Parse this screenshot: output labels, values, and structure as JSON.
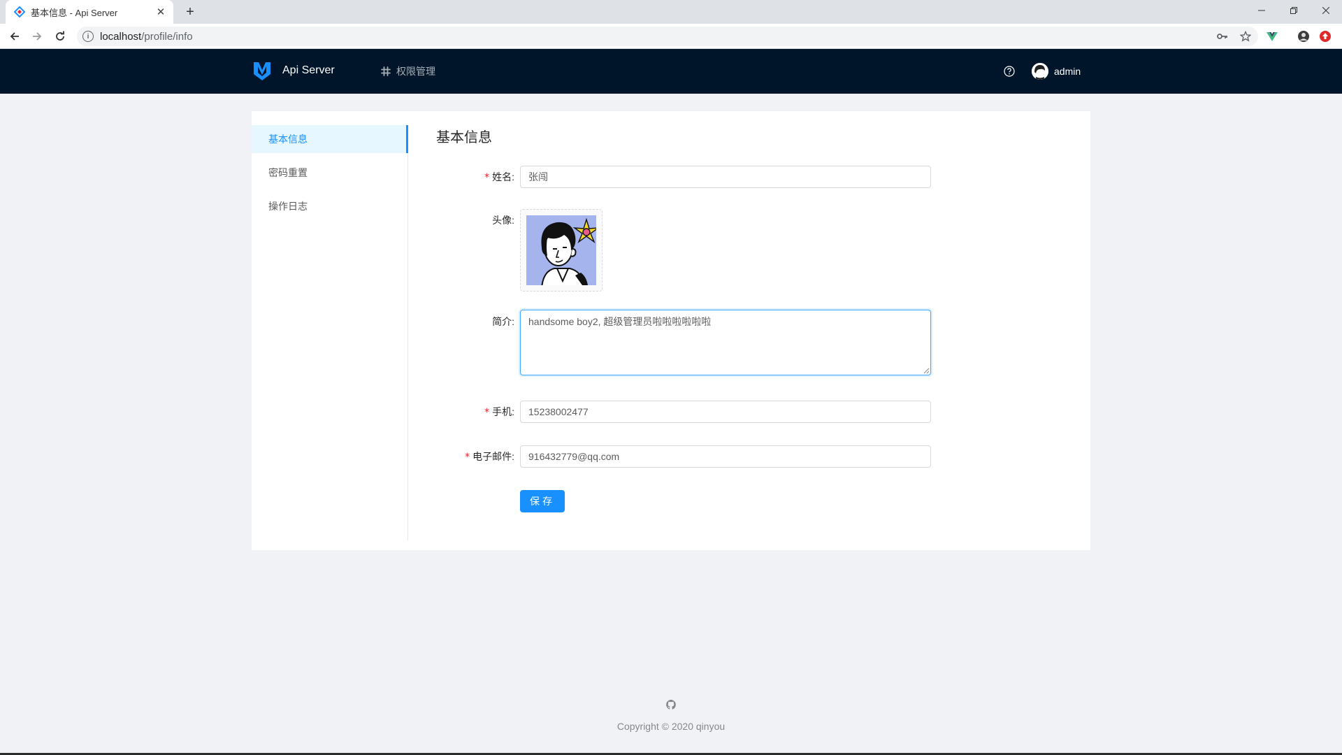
{
  "browser": {
    "tab_title": "基本信息 - Api Server",
    "url_host": "localhost",
    "url_path": "/profile/info"
  },
  "header": {
    "app_title": "Api Server",
    "menu": {
      "label": "权限管理"
    },
    "username": "admin"
  },
  "sidebar": {
    "items": [
      {
        "label": "基本信息",
        "active": true
      },
      {
        "label": "密码重置",
        "active": false
      },
      {
        "label": "操作日志",
        "active": false
      }
    ]
  },
  "main": {
    "title": "基本信息",
    "form": {
      "name": {
        "label": "姓名",
        "required": true,
        "value": "张闯"
      },
      "avatar": {
        "label": "头像"
      },
      "bio": {
        "label": "简介",
        "value": "handsome boy2, 超级管理员啦啦啦啦啦啦"
      },
      "phone": {
        "label": "手机",
        "required": true,
        "value": "15238002477"
      },
      "email": {
        "label": "电子邮件",
        "required": true,
        "value": "916432779@qq.com"
      },
      "submit_label": "保存"
    }
  },
  "footer": {
    "copyright": "Copyright © 2020 qinyou"
  },
  "colors": {
    "header_bg": "#001529",
    "primary": "#1890ff",
    "page_bg": "#f0f2f5",
    "required": "#f5222d",
    "avatar_bg": "#a6b4ee"
  }
}
